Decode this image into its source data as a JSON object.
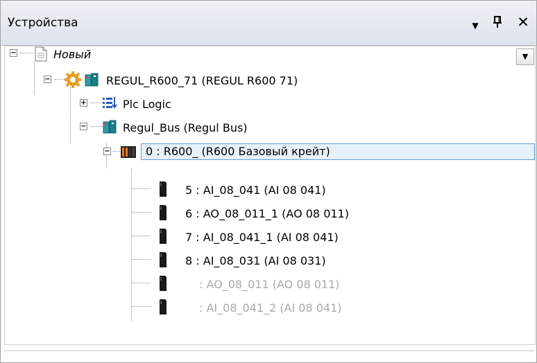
{
  "panel": {
    "title": "Устройства",
    "menu_icon": "dropdown-triangle-icon",
    "pin_icon": "pin-icon",
    "close_icon": "close-icon"
  },
  "tree": {
    "root": {
      "label": "Новый",
      "icon": "document-icon",
      "expanded": true
    },
    "device": {
      "label": "REGUL_R600_71 (REGUL R600 71)",
      "icon": "gear-device-icon",
      "expanded": true
    },
    "plc_logic": {
      "label": "Plc Logic",
      "icon": "plc-logic-icon",
      "expanded": false
    },
    "bus": {
      "label": "Regul_Bus (Regul Bus)",
      "icon": "bus-icon",
      "expanded": true
    },
    "crate": {
      "label": "0 : R600_ (R600 Базовый крейт)",
      "icon": "crate-icon",
      "expanded": true,
      "selected": true
    },
    "modules": [
      {
        "label": "5 : AI_08_041 (AI 08 041)",
        "enabled": true
      },
      {
        "label": "6 : AO_08_011_1 (AO 08 011)",
        "enabled": true
      },
      {
        "label": "7 : AI_08_041_1 (AI 08 041)",
        "enabled": true
      },
      {
        "label": "8 : AI_08_031 (AI 08 031)",
        "enabled": true
      },
      {
        "label": ": AO_08_011 (AO 08 011)",
        "enabled": false
      },
      {
        "label": ": AI_08_041_2 (AI 08 041)",
        "enabled": false
      }
    ]
  },
  "colors": {
    "selection_border": "#5aa0dc",
    "selection_fill": "#e6f1fb",
    "disabled_text": "#a8a8a8",
    "gear_orange": "#e8a020",
    "bus_teal": "#2e9aa6"
  }
}
